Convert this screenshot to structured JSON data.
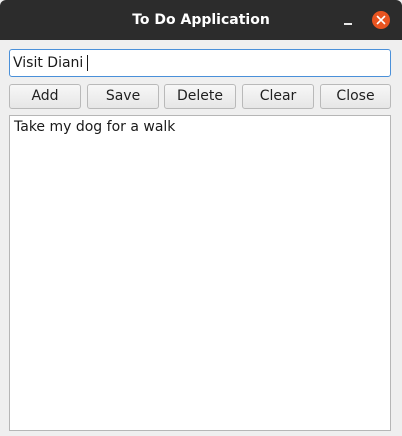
{
  "window": {
    "title": "To Do Application"
  },
  "task_input": {
    "value": "Visit Diani"
  },
  "toolbar": {
    "add_label": "Add",
    "save_label": "Save",
    "delete_label": "Delete",
    "clear_label": "Clear",
    "close_label": "Close"
  },
  "task_list": {
    "items": [
      {
        "label": "Take my dog for a walk"
      }
    ]
  },
  "colors": {
    "titlebar": "#2c2c2c",
    "close_button": "#e95420",
    "input_focus_border": "#4a90d9"
  },
  "icons": {
    "minimize": "minimize-icon",
    "close": "close-icon"
  }
}
